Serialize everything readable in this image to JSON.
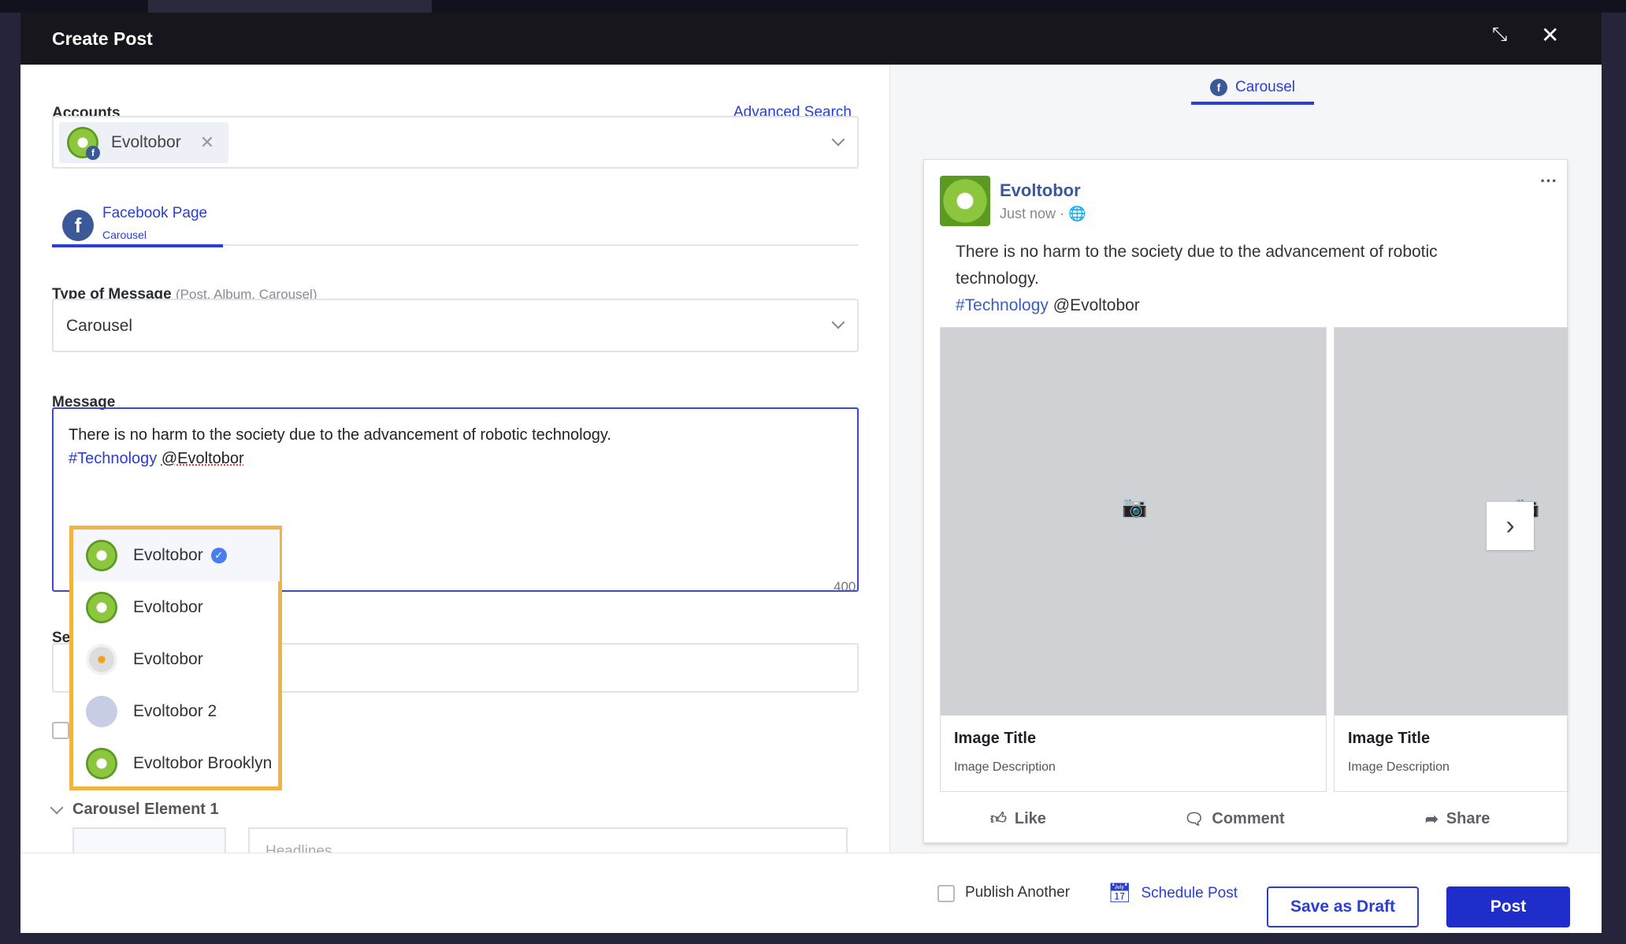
{
  "window": {
    "title": "Create Post"
  },
  "accounts": {
    "label": "Accounts",
    "advanced_search": "Advanced Search",
    "selected": "Evoltobor"
  },
  "channel_tab": {
    "name": "Facebook Page",
    "type": "Carousel"
  },
  "message_type": {
    "label": "Type of Message",
    "hint": "(Post, Album, Carousel)",
    "value": "Carousel"
  },
  "message": {
    "label": "Message",
    "line1": "There is no harm to the society due to the advancement of robotic technology.",
    "hashtag": "#Technology",
    "mention": "@Evoltobor",
    "char_count": "400"
  },
  "mention_dropdown": {
    "items": [
      {
        "label": "Evoltobor",
        "verified": true
      },
      {
        "label": "Evoltobor"
      },
      {
        "label": "Evoltobor"
      },
      {
        "label": "Evoltobor 2"
      },
      {
        "label": "Evoltobor Brooklyn"
      }
    ]
  },
  "partial_label": "Se",
  "carousel_element": {
    "label": "Carousel Element 1",
    "headline_placeholder": "Headlines"
  },
  "preview": {
    "tab": "Carousel",
    "page_name": "Evoltobor",
    "time": "Just now ·",
    "text_line1": "There is no harm to the society due to the advancement of robotic",
    "text_line2": "technology.",
    "hashtag": "#Technology",
    "mention": "@Evoltobor",
    "cards": [
      {
        "title": "Image Title",
        "description": "Image Description"
      },
      {
        "title": "Image Title",
        "description": "Image Description"
      }
    ],
    "actions": {
      "like": "Like",
      "comment": "Comment",
      "share": "Share"
    }
  },
  "footer": {
    "publish_another": "Publish Another",
    "schedule_post": "Schedule Post",
    "save_draft": "Save as Draft",
    "post": "Post"
  },
  "colors": {
    "accent": "#2a3fd1",
    "primary_button": "#1f2ecb",
    "highlight": "#f0b443",
    "header": "#16161c"
  }
}
